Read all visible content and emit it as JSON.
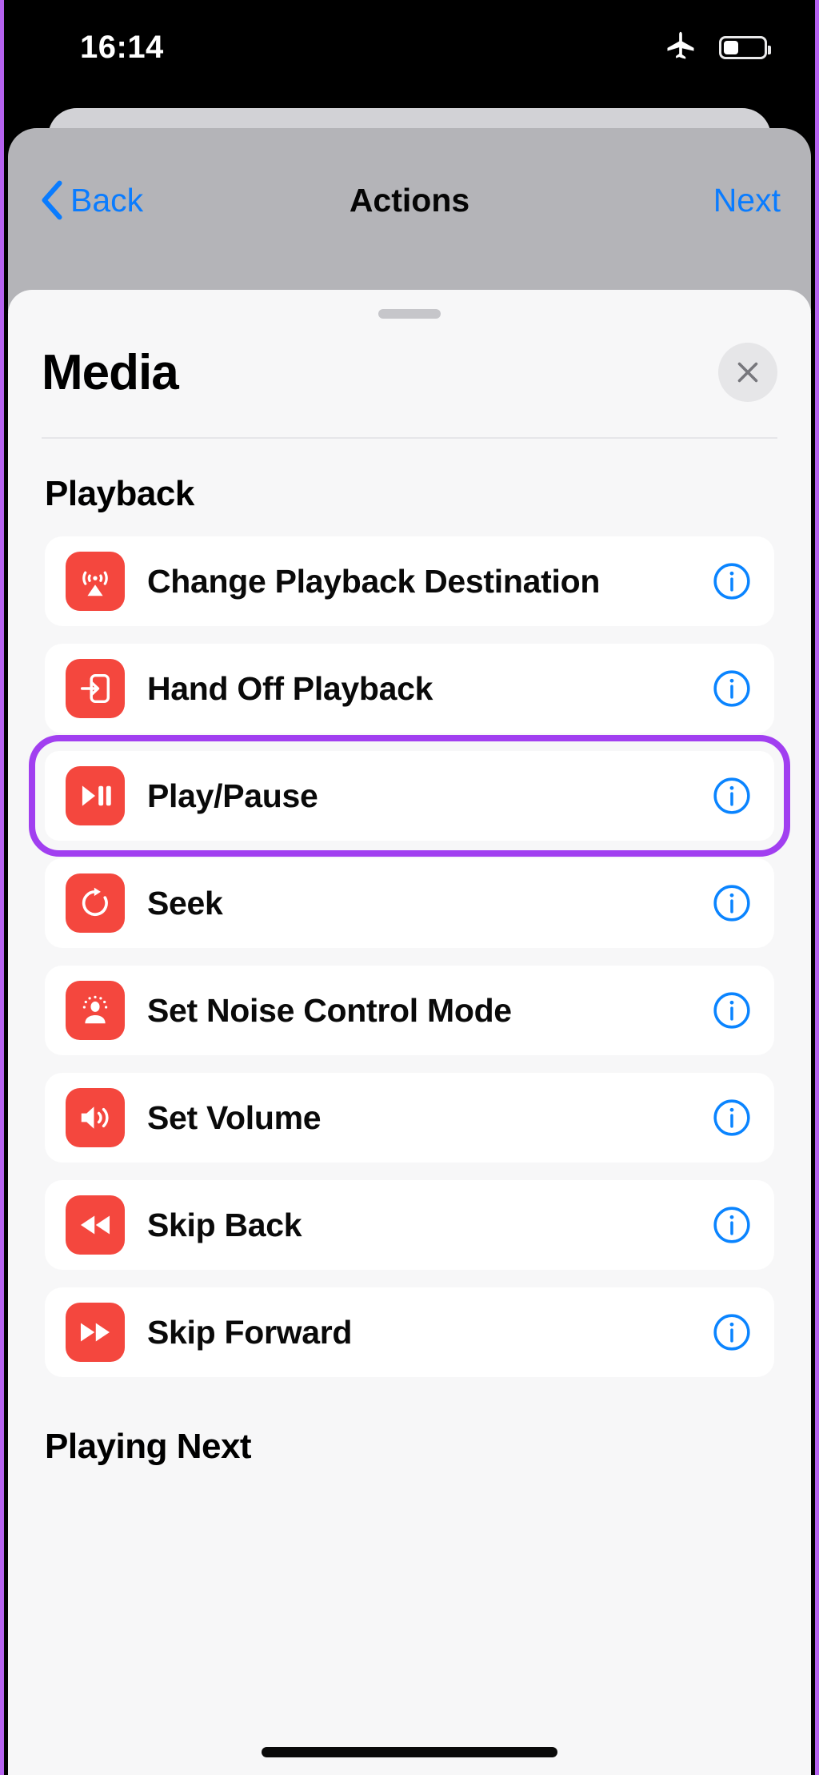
{
  "statusbar": {
    "time": "16:14",
    "airplane_icon": "airplane-mode-icon",
    "battery_icon": "battery-icon",
    "battery_level_percent": 35
  },
  "navbar": {
    "back_label": "Back",
    "title": "Actions",
    "next_label": "Next",
    "accent_color": "#0a7cff",
    "background_color": "#b4b4b8"
  },
  "sheet": {
    "title": "Media",
    "close_icon": "close-icon",
    "grabber": "drag-handle",
    "background_color": "#f7f7f8"
  },
  "sections": [
    {
      "title": "Playback",
      "rows": [
        {
          "label": "Change Playback Destination",
          "icon": "airplay-icon",
          "info_icon": "info-icon",
          "highlighted": false
        },
        {
          "label": "Hand Off Playback",
          "icon": "hand-off-icon",
          "info_icon": "info-icon",
          "highlighted": false
        },
        {
          "label": "Play/Pause",
          "icon": "play-pause-icon",
          "info_icon": "info-icon",
          "highlighted": true
        },
        {
          "label": "Seek",
          "icon": "seek-rotate-icon",
          "info_icon": "info-icon",
          "highlighted": false
        },
        {
          "label": "Set Noise Control Mode",
          "icon": "noise-control-icon",
          "info_icon": "info-icon",
          "highlighted": false
        },
        {
          "label": "Set Volume",
          "icon": "speaker-volume-icon",
          "info_icon": "info-icon",
          "highlighted": false
        },
        {
          "label": "Skip Back",
          "icon": "skip-back-icon",
          "info_icon": "info-icon",
          "highlighted": false
        },
        {
          "label": "Skip Forward",
          "icon": "skip-forward-icon",
          "info_icon": "info-icon",
          "highlighted": false
        }
      ]
    },
    {
      "title": "Playing Next",
      "rows": []
    }
  ],
  "colors": {
    "icon_red": "#f4473e",
    "info_blue": "#0a84ff",
    "highlight_purple": "#a13ff0",
    "screenshot_border_purple": "#b663f0"
  }
}
